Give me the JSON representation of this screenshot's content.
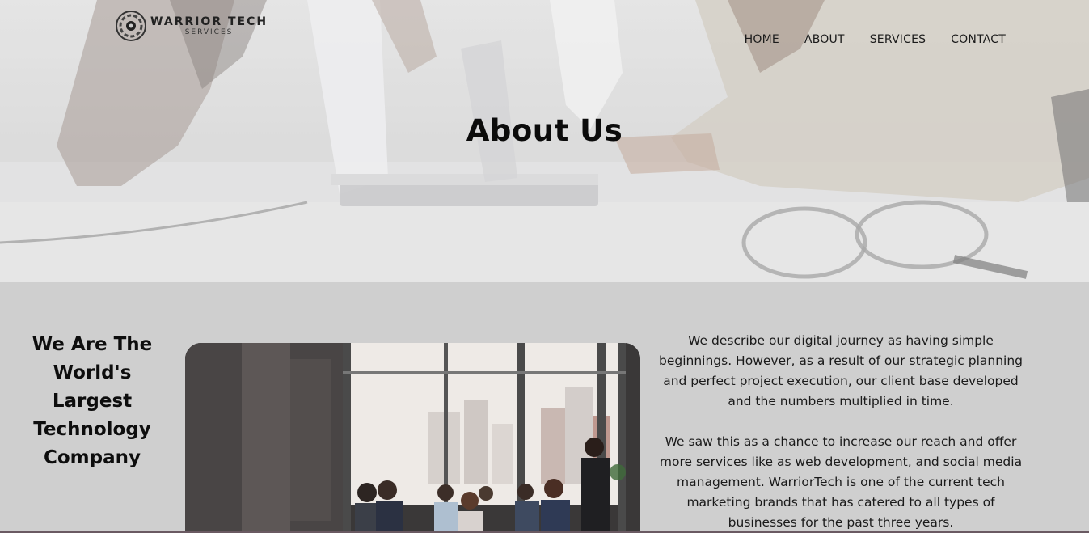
{
  "brand": {
    "title": "WARRIOR TECH",
    "subtitle": "SERVICES"
  },
  "nav": {
    "items": [
      "HOME",
      "ABOUT",
      "SERVICES",
      "CONTACT"
    ]
  },
  "hero": {
    "title": "About Us"
  },
  "section": {
    "headline": "We Are The World's Largest Technology Company",
    "paragraphs": [
      "We describe our digital journey as having simple beginnings. However, as a result of our strategic planning and perfect project execution, our client base developed and the numbers multiplied in time.",
      "We saw this as a chance to increase our reach and offer more services like as web development, and social media management. WarriorTech is one of the current tech marketing brands that has catered to all types of businesses for the past three years."
    ]
  },
  "icons": {
    "logo": "warrior-tech-logo-icon"
  }
}
